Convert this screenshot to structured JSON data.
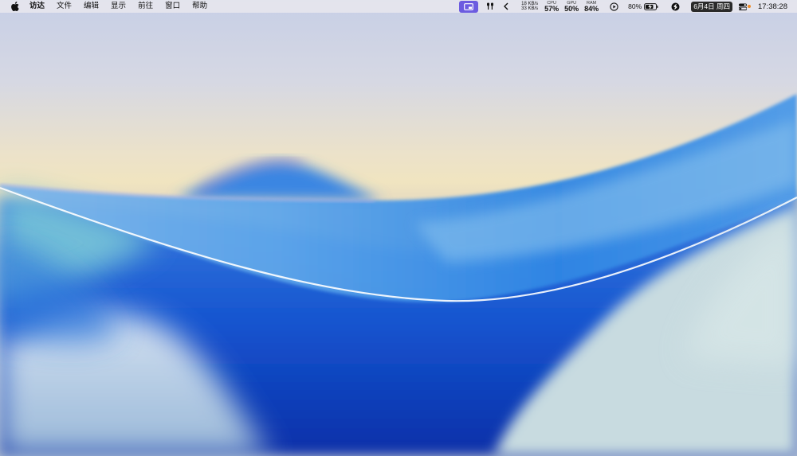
{
  "menubar": {
    "apple_icon": "apple-logo-icon",
    "app_name": "访达",
    "items": [
      "文件",
      "编辑",
      "显示",
      "前往",
      "窗口",
      "帮助"
    ]
  },
  "status": {
    "network_up": "18 KB/s",
    "network_down": "33 KB/s",
    "cpu_label": "CPU",
    "cpu_value": "57%",
    "gpu_label": "GPU",
    "gpu_value": "50%",
    "ram_label": "RAM",
    "ram_value": "84%",
    "battery_percent": "80%",
    "date": "6月4日 周四",
    "time": "17:38:28",
    "accent_color": "#6c5ce0",
    "notification_dot_color": "#f08a24"
  },
  "tray_icons": [
    "screen-capture-icon",
    "airpods-icon",
    "chevron-left-icon",
    "play-circle-icon",
    "battery-charging-icon",
    "shazam-icon",
    "control-center-icon"
  ]
}
